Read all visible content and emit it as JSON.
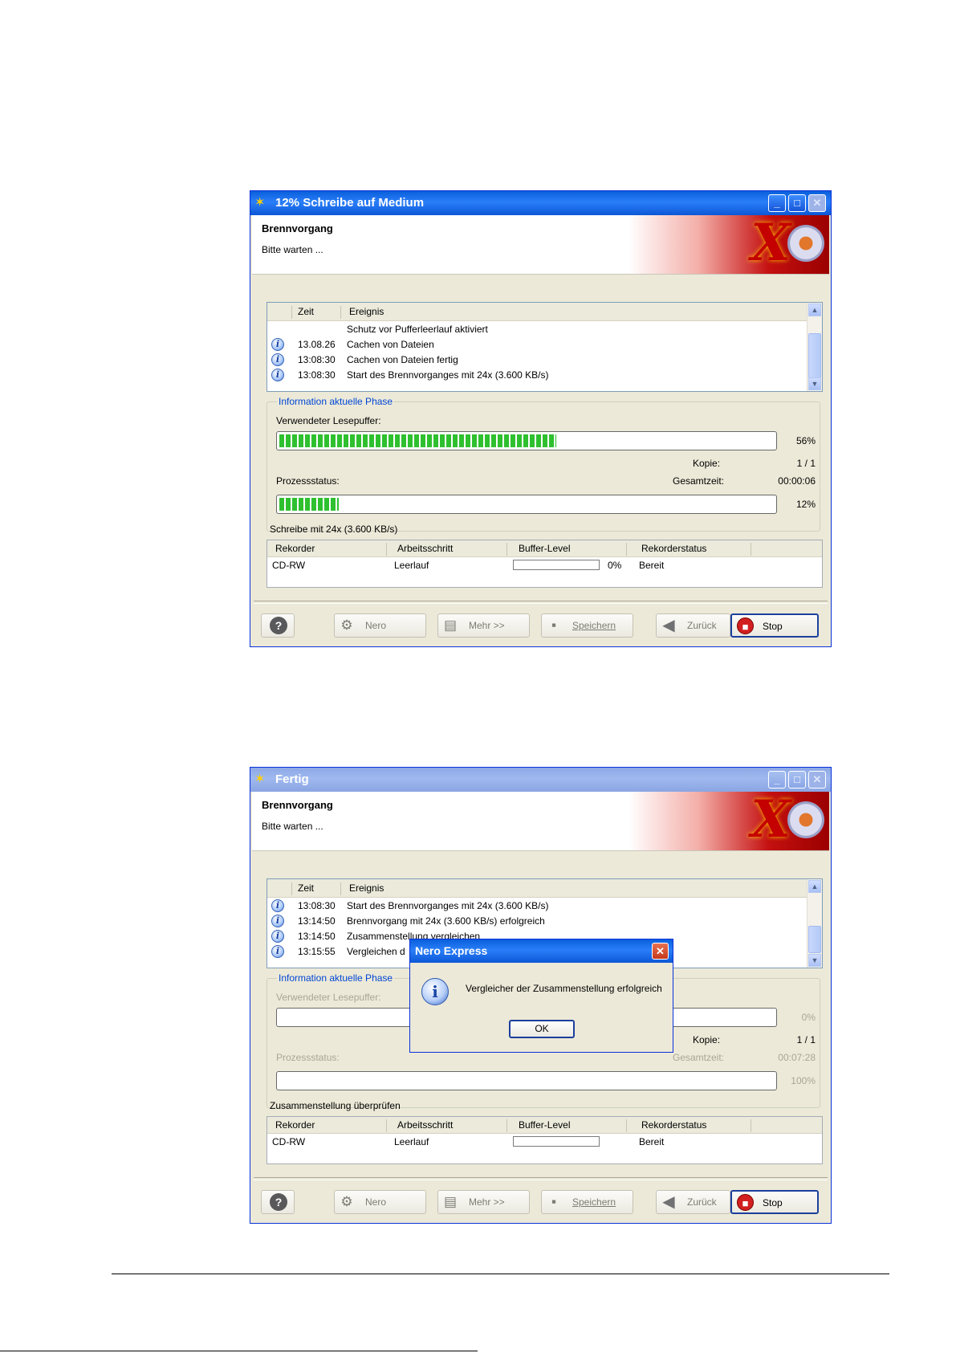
{
  "windows": [
    {
      "title": "12% Schreibe auf Medium",
      "header_title": "Brennvorgang",
      "header_subtitle": "Bitte warten ...",
      "log_columns": {
        "time": "Zeit",
        "event": "Ereignis"
      },
      "log_rows": [
        {
          "icon": "",
          "time": "",
          "event": "Schutz vor Pufferleerlauf aktiviert"
        },
        {
          "icon": "info-icon",
          "time": "13.08.26",
          "event": "Cachen von Dateien"
        },
        {
          "icon": "info-icon",
          "time": "13:08:30",
          "event": "Cachen von Dateien fertig"
        },
        {
          "icon": "info-icon",
          "time": "13:08:30",
          "event": "Start des Brennvorganges mit 24x (3.600 KB/s)"
        }
      ],
      "phase_legend": "Information aktuelle Phase",
      "buffer_label": "Verwendeter Lesepuffer:",
      "buffer_percent": "56%",
      "buffer_fill": 0.56,
      "copy_label": "Kopie:",
      "copy_value": "1 / 1",
      "process_label": "Prozessstatus:",
      "total_time_label": "Gesamtzeit:",
      "total_time_value": "00:00:06",
      "process_percent": "12%",
      "process_fill": 0.12,
      "status_line": "Schreibe mit 24x (3.600 KB/s)",
      "recorder_columns": {
        "recorder": "Rekorder",
        "step": "Arbeitsschritt",
        "buffer": "Buffer-Level",
        "status": "Rekorderstatus"
      },
      "recorder_row": {
        "recorder": "CD-RW",
        "step": "Leerlauf",
        "buffer_percent": "0%",
        "status": "Bereit"
      }
    },
    {
      "title": "Fertig",
      "header_title": "Brennvorgang",
      "header_subtitle": "Bitte warten ...",
      "log_columns": {
        "time": "Zeit",
        "event": "Ereignis"
      },
      "log_rows": [
        {
          "icon": "info-icon",
          "time": "13:08:30",
          "event": "Start des Brennvorganges mit 24x (3.600 KB/s)"
        },
        {
          "icon": "info-icon",
          "time": "13:14:50",
          "event": "Brennvorgang mit 24x (3.600 KB/s) erfolgreich"
        },
        {
          "icon": "info-icon",
          "time": "13:14:50",
          "event": "Zusammenstellung vergleichen"
        },
        {
          "icon": "info-icon",
          "time": "13:15:55",
          "event": "Vergleichen d"
        }
      ],
      "phase_legend": "Information aktuelle Phase",
      "buffer_label": "Verwendeter Lesepuffer:",
      "buffer_percent": "0%",
      "buffer_fill": 0,
      "copy_label": "Kopie:",
      "copy_value": "1 / 1",
      "process_label": "Prozessstatus:",
      "total_time_label": "Gesamtzeit:",
      "total_time_value": "00:07:28",
      "process_percent": "100%",
      "process_fill": 0,
      "status_line": "Zusammenstellung überprüfen",
      "recorder_columns": {
        "recorder": "Rekorder",
        "step": "Arbeitsschritt",
        "buffer": "Buffer-Level",
        "status": "Rekorderstatus"
      },
      "recorder_row": {
        "recorder": "CD-RW",
        "step": "Leerlauf",
        "buffer_percent": "",
        "status": "Bereit"
      }
    }
  ],
  "buttons": {
    "help": "?",
    "nero": "Nero",
    "more": "Mehr >>",
    "save": "Speichern",
    "back": "Zurück",
    "stop": "Stop"
  },
  "dialog": {
    "title": "Nero Express",
    "message": "Vergleicher der Zusammenstellung erfolgreich",
    "ok": "OK"
  },
  "colors": {
    "titlebar_active": "#0a5fdc",
    "titlebar_inactive": "#8ca8e6",
    "progress_fill": "#2fc02f",
    "phase_legend": "#0046d5"
  }
}
